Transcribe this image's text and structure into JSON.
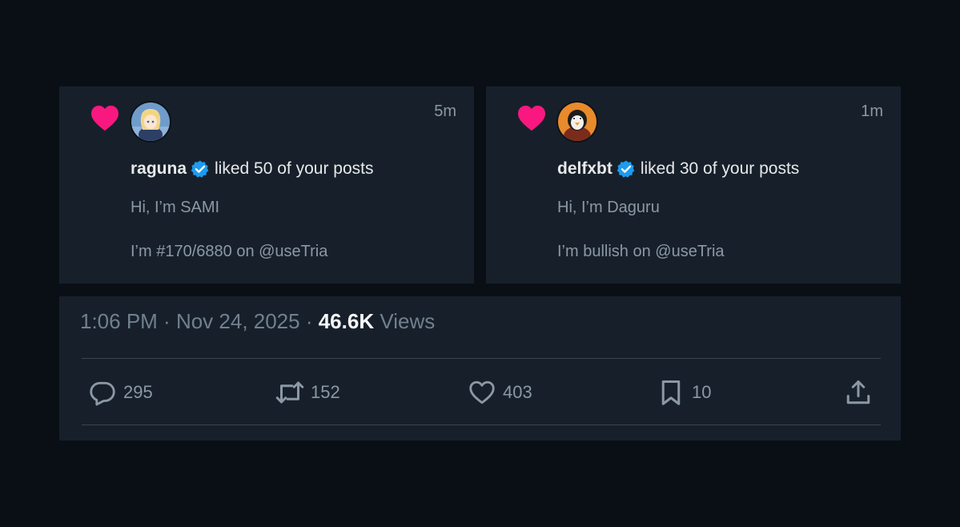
{
  "notifications": [
    {
      "username": "raguna",
      "action_text": "liked 50 of your posts",
      "time": "5m",
      "line1": "Hi, I’m SAMI",
      "line2": "I’m #170/6880 on @useTria"
    },
    {
      "username": "delfxbt",
      "action_text": "liked 30 of your posts",
      "time": "1m",
      "line1": "Hi, I’m Daguru",
      "line2": "I’m bullish on @useTria"
    }
  ],
  "post_meta": {
    "time": "1:06 PM",
    "separator": " · ",
    "date": "Nov 24, 2025",
    "views_count": "46.6K",
    "views_label": " Views"
  },
  "actions": {
    "replies": "295",
    "reposts": "152",
    "likes": "403",
    "bookmarks": "10"
  },
  "colors": {
    "background": "#0a0f16",
    "card": "#17202a",
    "heart": "#f91880",
    "verified": "#1d9bf0",
    "muted_text": "#8b98a5"
  },
  "icons": [
    "heart-icon",
    "verified-badge-icon",
    "reply-icon",
    "retweet-icon",
    "like-icon",
    "bookmark-icon",
    "share-icon"
  ]
}
